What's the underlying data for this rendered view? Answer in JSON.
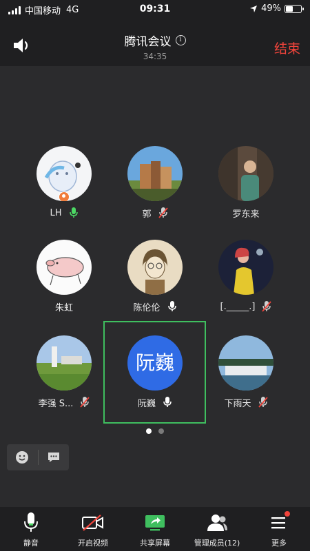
{
  "status_bar": {
    "carrier": "中国移动",
    "network": "4G",
    "time": "09:31",
    "battery": "49%",
    "battery_level": 0.49
  },
  "header": {
    "title": "腾讯会议",
    "duration": "34:35",
    "end_label": "结束"
  },
  "participants": [
    {
      "name": "LH",
      "mic": "on",
      "avatar": "cartoon-bear",
      "host": true
    },
    {
      "name": "郭",
      "mic": "muted",
      "avatar": "buildings-photo"
    },
    {
      "name": "罗东来",
      "mic": "none",
      "avatar": "person-photo"
    },
    {
      "name": "朱虹",
      "mic": "none",
      "avatar": "pig-drawing"
    },
    {
      "name": "陈伦伦",
      "mic": "on",
      "avatar": "sketch-portrait"
    },
    {
      "name": "[._____.]",
      "mic": "muted",
      "avatar": "night-photo"
    },
    {
      "name": "李强 S...",
      "mic": "muted",
      "avatar": "lighthouse-photo"
    },
    {
      "name": "阮巍",
      "mic": "on",
      "avatar_text": "阮巍",
      "selected": true
    },
    {
      "name": "下雨天",
      "mic": "muted",
      "avatar": "harbor-photo"
    }
  ],
  "pagination": {
    "pages": 2,
    "current": 1
  },
  "toolbar": {
    "items": [
      {
        "label": "静音",
        "icon": "microphone-icon"
      },
      {
        "label": "开启视频",
        "icon": "video-off-icon"
      },
      {
        "label": "共享屏幕",
        "icon": "share-screen-icon"
      },
      {
        "label": "管理成员(12)",
        "icon": "members-icon"
      },
      {
        "label": "更多",
        "icon": "more-menu-icon"
      }
    ]
  },
  "colors": {
    "accent_green": "#3fbf5f",
    "end_red": "#f2443b",
    "avatar_blue": "#2f6be5"
  }
}
